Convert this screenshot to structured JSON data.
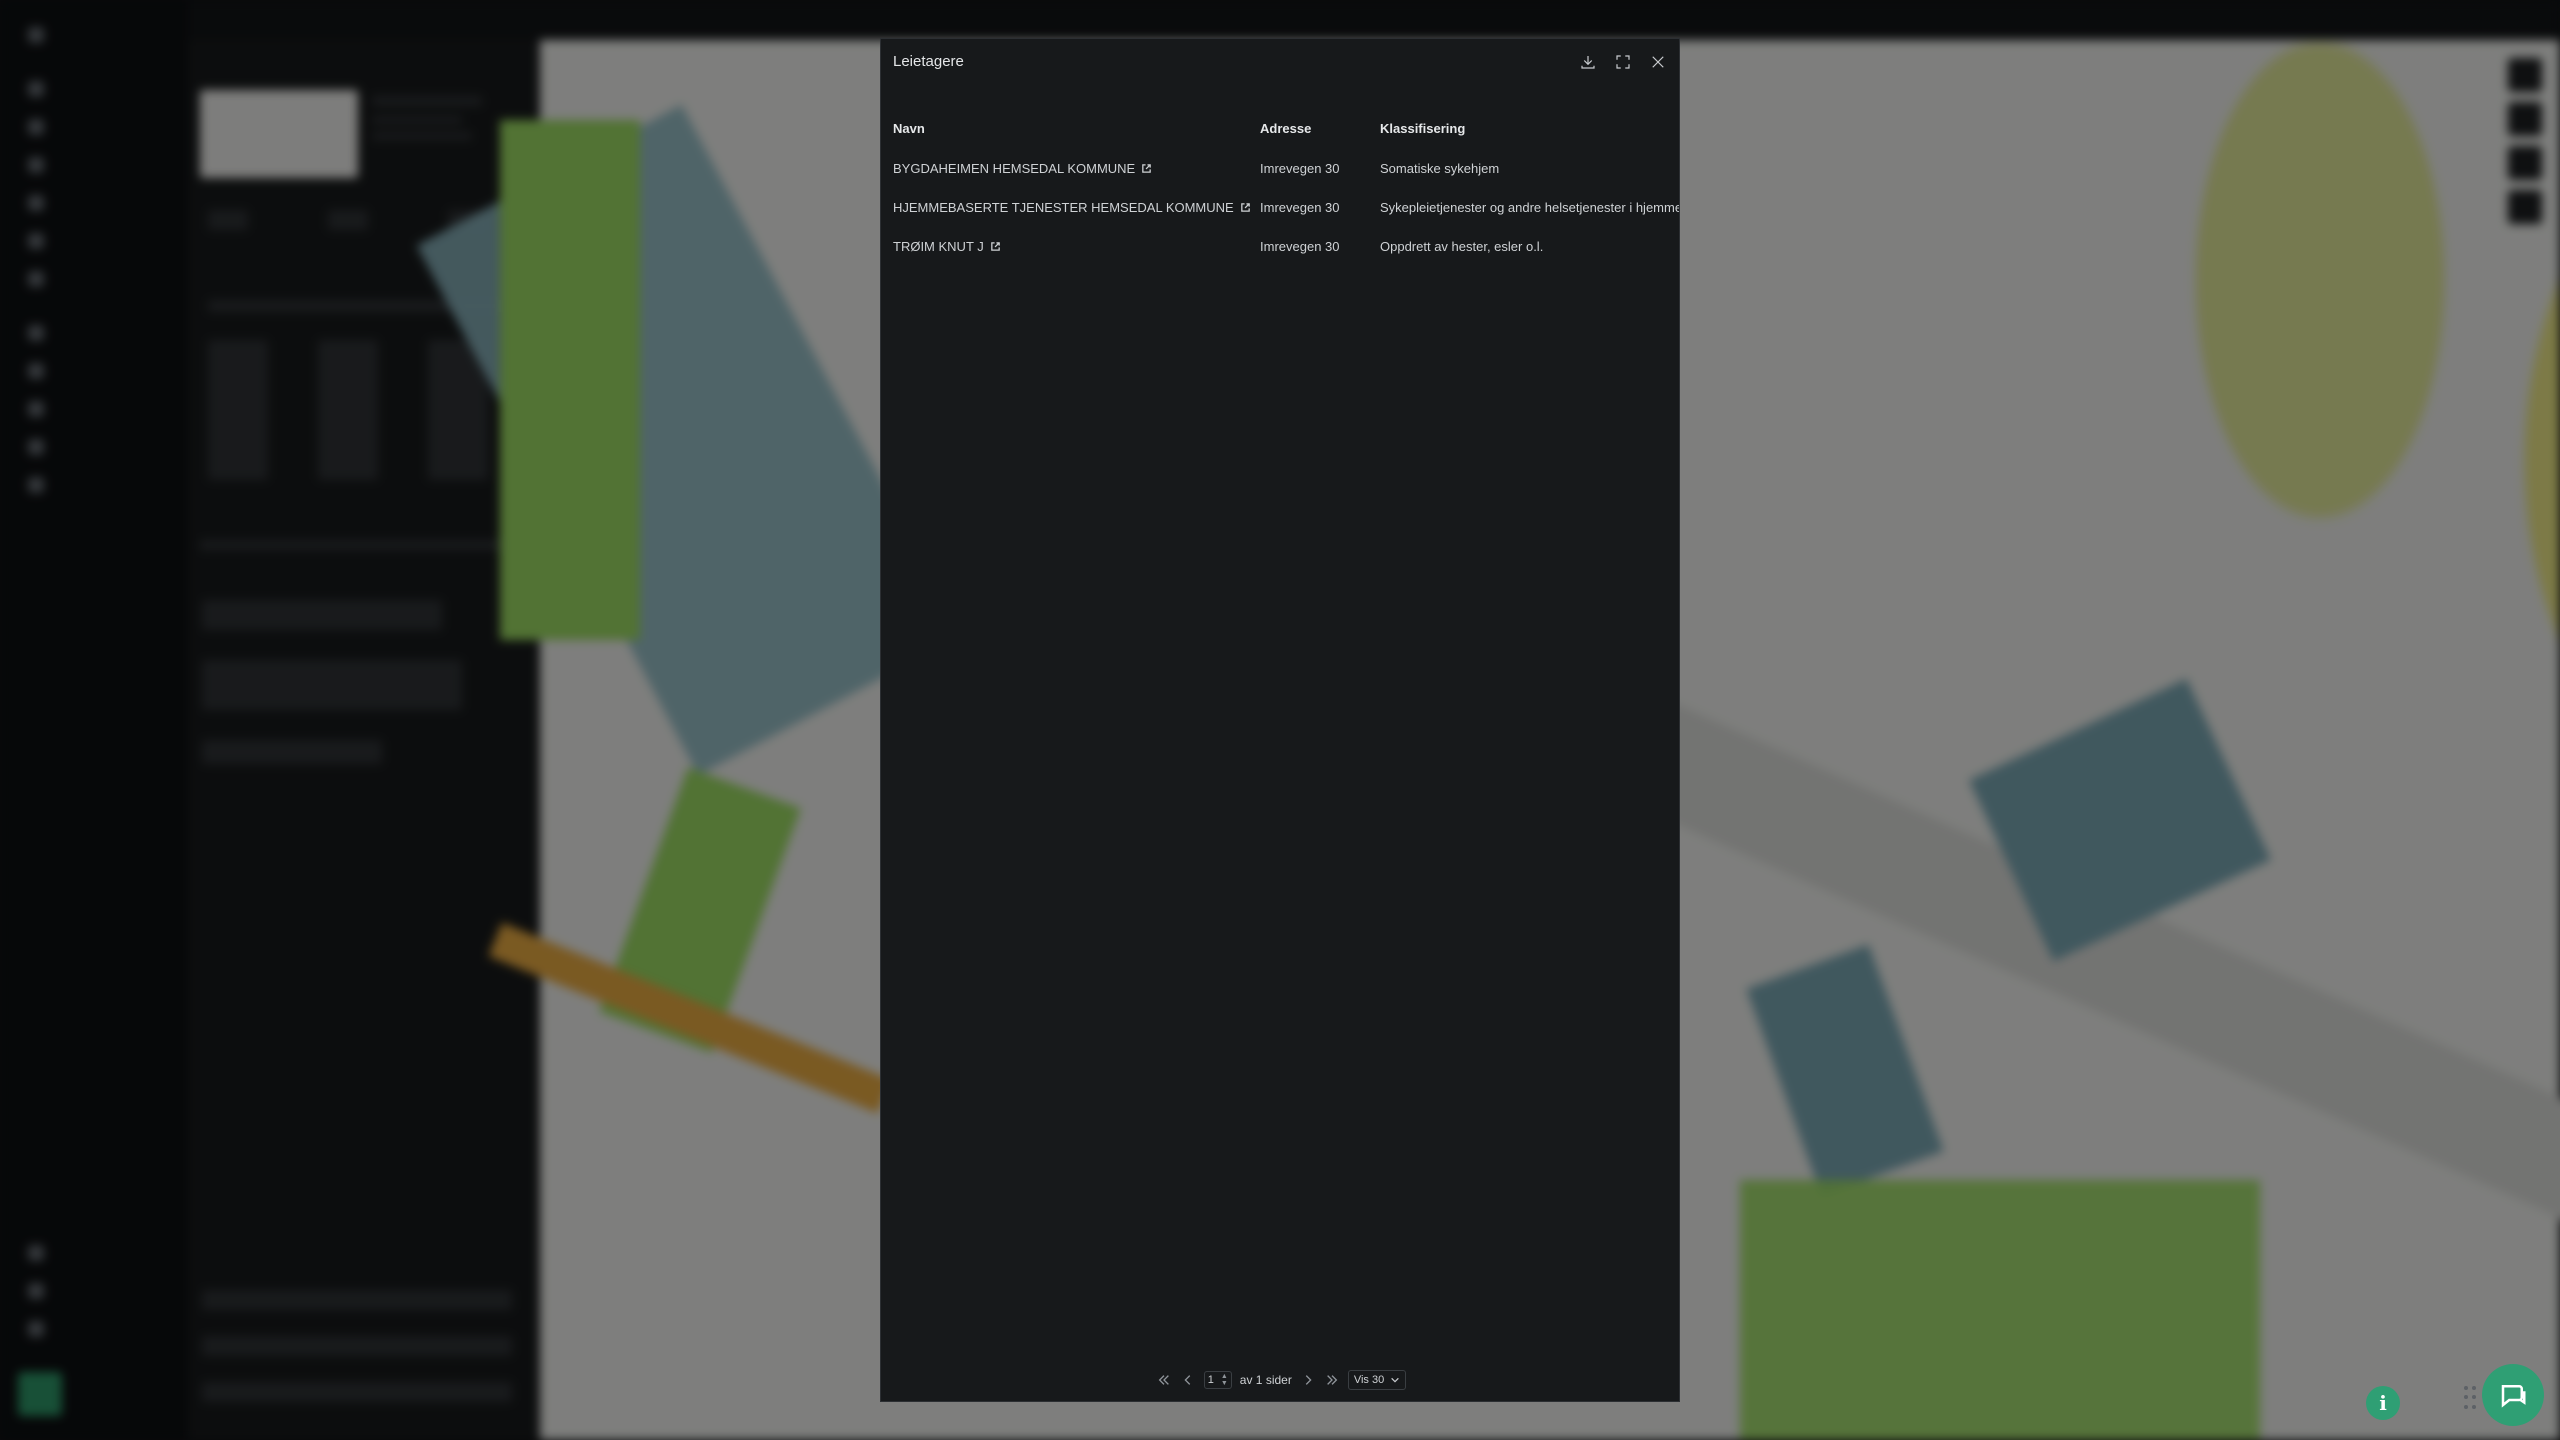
{
  "modal": {
    "title": "Leietagere",
    "download_icon": "download-icon",
    "expand_icon": "fullscreen-icon",
    "close_icon": "close-icon",
    "columns": {
      "name": "Navn",
      "address": "Adresse",
      "classification": "Klassifisering"
    },
    "rows": [
      {
        "name": "BYGDAHEIMEN HEMSEDAL KOMMUNE",
        "address": "Imrevegen 30",
        "classification": "Somatiske sykehjem"
      },
      {
        "name": "HJEMMEBASERTE TJENESTER HEMSEDAL KOMMUNE",
        "address": "Imrevegen 30",
        "classification": "Sykepleietjenester og andre helsetjenester i hjemmet"
      },
      {
        "name": "TRØIM KNUT J",
        "address": "Imrevegen 30",
        "classification": "Oppdrett av hester, esler o.l."
      }
    ],
    "pager": {
      "page": "1",
      "of_text": "av 1 sider",
      "per_page": "Vis 30"
    }
  },
  "colors": {
    "accent": "#2f9f74",
    "modal_bg": "#17191b",
    "backdrop": "#0f1113"
  },
  "icons": {
    "chat": "chat-icon",
    "info": "info-icon",
    "external": "external-link-icon"
  },
  "info_glyph": "i"
}
